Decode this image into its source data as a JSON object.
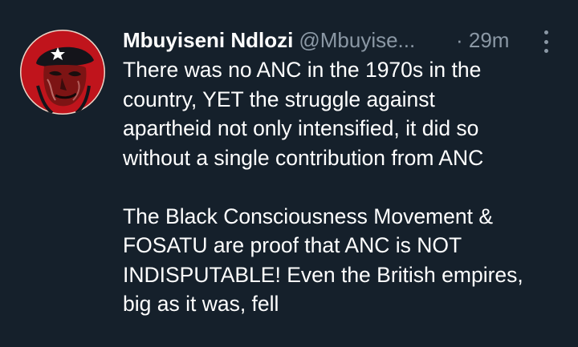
{
  "tweet": {
    "author_name": "Mbuyiseni Ndlozi",
    "author_handle": "@Mbuyise...",
    "time": "· 29m",
    "more_icon": "more-vertical-icon",
    "avatar": "avatar",
    "paragraphs": [
      {
        "lines": [
          "There was no ANC in the 1970s in the",
          "country, YET the struggle against",
          "apartheid not only intensified, it did so",
          "without a single contribution from ANC"
        ]
      },
      {
        "lines": [
          "The Black Consciousness Movement &",
          "FOSATU are proof that ANC is NOT",
          "INDISPUTABLE! Even the British empires,",
          "big as it was, fell"
        ]
      }
    ]
  },
  "colors": {
    "background": "#15202b",
    "text": "#ffffff",
    "secondary": "#8b98a5",
    "avatar_red": "#c0141c"
  }
}
